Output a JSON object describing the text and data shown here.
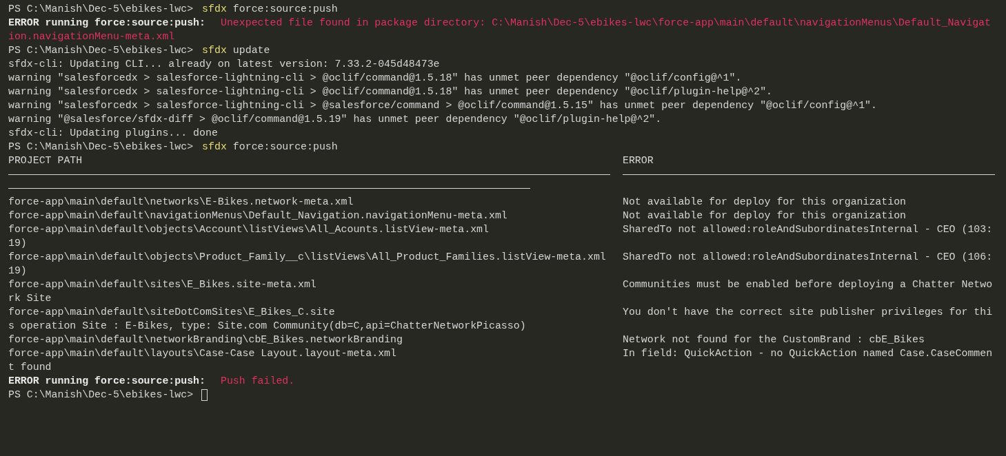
{
  "terminal": {
    "lines": [
      {
        "kind": "prompt",
        "prompt": "PS C:\\Manish\\Dec-5\\ebikes-lwc>",
        "command": "sfdx",
        "args": "force:source:push"
      },
      {
        "kind": "error",
        "label": "ERROR running force:source:push:",
        "message": "Unexpected file found in package directory: C:\\Manish\\Dec-5\\ebikes-lwc\\force-app\\main\\default\\navigationMenus\\Default_Navigat"
      },
      {
        "kind": "error_cont",
        "text": "ion.navigationMenu-meta.xml"
      },
      {
        "kind": "prompt",
        "prompt": "PS C:\\Manish\\Dec-5\\ebikes-lwc>",
        "command": "sfdx",
        "args": "update"
      },
      {
        "kind": "plain",
        "text": "sfdx-cli: Updating CLI... already on latest version: 7.33.2-045d48473e"
      },
      {
        "kind": "plain",
        "text": "warning \"salesforcedx > salesforce-lightning-cli > @oclif/command@1.5.18\" has unmet peer dependency \"@oclif/config@^1\"."
      },
      {
        "kind": "plain",
        "text": "warning \"salesforcedx > salesforce-lightning-cli > @oclif/command@1.5.18\" has unmet peer dependency \"@oclif/plugin-help@^2\"."
      },
      {
        "kind": "plain",
        "text": "warning \"salesforcedx > salesforce-lightning-cli > @salesforce/command > @oclif/command@1.5.15\" has unmet peer dependency \"@oclif/config@^1\"."
      },
      {
        "kind": "plain",
        "text": "warning \"@salesforce/sfdx-diff > @oclif/command@1.5.19\" has unmet peer dependency \"@oclif/plugin-help@^2\"."
      },
      {
        "kind": "plain",
        "text": "sfdx-cli: Updating plugins... done"
      },
      {
        "kind": "prompt",
        "prompt": "PS C:\\Manish\\Dec-5\\ebikes-lwc>",
        "command": "sfdx",
        "args": "force:source:push"
      }
    ],
    "table": {
      "columns": [
        "PROJECT PATH",
        "ERROR"
      ],
      "rows": [
        {
          "path": "force-app\\main\\default\\networks\\E-Bikes.network-meta.xml",
          "error": "Not available for deploy for this organization"
        },
        {
          "path": "force-app\\main\\default\\navigationMenus\\Default_Navigation.navigationMenu-meta.xml",
          "error": "Not available for deploy for this organization"
        },
        {
          "path": "force-app\\main\\default\\objects\\Account\\listViews\\All_Acounts.listView-meta.xml",
          "error": "SharedTo not allowed:roleAndSubordinatesInternal - CEO (103:",
          "wrap": "19)"
        },
        {
          "path": "force-app\\main\\default\\objects\\Product_Family__c\\listViews\\All_Product_Families.listView-meta.xml",
          "error": "SharedTo not allowed:roleAndSubordinatesInternal - CEO (106:",
          "wrap": "19)"
        },
        {
          "path": "force-app\\main\\default\\sites\\E_Bikes.site-meta.xml",
          "error": "Communities must be enabled before deploying a Chatter Netwo",
          "wrap": "rk Site"
        },
        {
          "path": "force-app\\main\\default\\siteDotComSites\\E_Bikes_C.site",
          "error": "You don't have the correct site publisher privileges for thi",
          "wrap": "s operation Site : E-Bikes, type: Site.com Community(db=C,api=ChatterNetworkPicasso)"
        },
        {
          "path": "force-app\\main\\default\\networkBranding\\cbE_Bikes.networkBranding",
          "error": "Network not found for the CustomBrand : cbE_Bikes"
        },
        {
          "path": "force-app\\main\\default\\layouts\\Case-Case Layout.layout-meta.xml",
          "error": "In field: QuickAction - no QuickAction named Case.CaseCommen",
          "wrap": "t found"
        }
      ]
    },
    "after": [
      {
        "kind": "error",
        "label": "ERROR running force:source:push:",
        "message": "Push failed."
      },
      {
        "kind": "prompt",
        "prompt": "PS C:\\Manish\\Dec-5\\ebikes-lwc>",
        "cursor": true
      }
    ]
  }
}
